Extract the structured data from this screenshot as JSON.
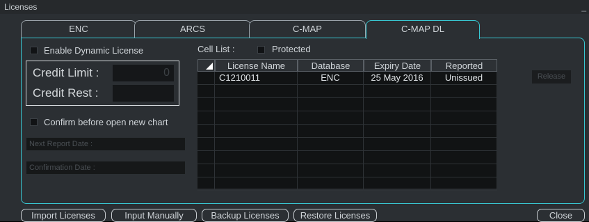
{
  "window": {
    "title": "Licenses",
    "minimize_glyph": "_"
  },
  "tabs": [
    {
      "label": "ENC",
      "active": false
    },
    {
      "label": "ARCS",
      "active": false
    },
    {
      "label": "C-MAP",
      "active": false
    },
    {
      "label": "C-MAP DL",
      "active": true
    }
  ],
  "options": {
    "enable_dynamic_license": "Enable Dynamic License",
    "confirm_before_open": "Confirm before open new chart"
  },
  "credit": {
    "limit_label": "Credit Limit :",
    "limit_value": "0",
    "rest_label": "Credit Rest :",
    "rest_value": ""
  },
  "dim_fields": {
    "next_report_date": "Next Report Date :",
    "confirmation_date": "Confirmation Date :"
  },
  "cell_list": {
    "label": "Cell List :",
    "protected_label": "Protected",
    "columns": [
      "License Name",
      "Database",
      "Expiry Date",
      "Reported"
    ],
    "rows": [
      [
        "C1210011",
        "ENC",
        "25 May 2016",
        "Unissued"
      ]
    ]
  },
  "release_button": "Release",
  "footer_buttons": {
    "import": "Import Licenses",
    "input_manually": "Input Manually",
    "backup": "Backup Licenses",
    "restore": "Restore Licenses",
    "close": "Close"
  },
  "colors": {
    "accent": "#38c7d2",
    "background": "#2b2f33",
    "table_bg": "#111314"
  }
}
